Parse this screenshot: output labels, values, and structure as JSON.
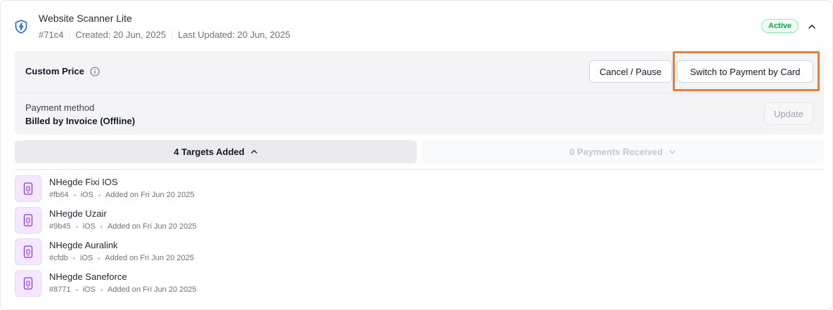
{
  "subscription": {
    "title": "Website Scanner Lite",
    "id": "#71c4",
    "created": "Created: 20 Jun, 2025",
    "updated": "Last Updated: 20 Jun, 2025",
    "status": "Active",
    "icon": "shield-bolt-icon"
  },
  "pricing": {
    "label": "Custom Price",
    "cancel_label": "Cancel / Pause",
    "switch_label": "Switch to Payment by Card",
    "payment_method_label": "Payment method",
    "payment_method_value": "Billed by Invoice (Offline)",
    "update_label": "Update"
  },
  "tabs": {
    "targets_label": "4 Targets Added",
    "payments_label": "0 Payments Received"
  },
  "targets": [
    {
      "name": "NHegde Fixi IOS",
      "id": "#fb64",
      "platform": "iOS",
      "added": "Added on Fri Jun 20 2025"
    },
    {
      "name": "NHegde Uzair",
      "id": "#9b45",
      "platform": "iOS",
      "added": "Added on Fri Jun 20 2025"
    },
    {
      "name": "NHegde Auralink",
      "id": "#cfdb",
      "platform": "iOS",
      "added": "Added on Fri Jun 20 2025"
    },
    {
      "name": "NHegde Saneforce",
      "id": "#8771",
      "platform": "iOS",
      "added": "Added on Fri Jun 20 2025"
    }
  ],
  "colors": {
    "accent_highlight": "#f47b20",
    "active_green": "#16a34a",
    "target_icon_bg": "#f3e8ff",
    "target_icon_fg": "#9333ea",
    "brand_blue": "#2563eb"
  }
}
